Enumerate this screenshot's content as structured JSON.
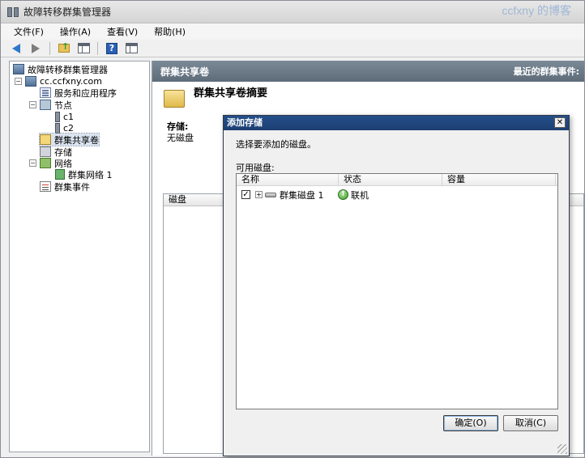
{
  "window": {
    "title": "故障转移群集管理器",
    "watermark": "ccfxny 的博客"
  },
  "menu": [
    "文件(F)",
    "操作(A)",
    "查看(V)",
    "帮助(H)"
  ],
  "tree": {
    "root": "故障转移群集管理器",
    "cluster": "cc.ccfxny.com",
    "apps": "服务和应用程序",
    "nodes": "节点",
    "node1": "c1",
    "node2": "c2",
    "csv": "群集共享卷",
    "storage": "存储",
    "networks": "网络",
    "network1": "群集网络 1",
    "events": "群集事件"
  },
  "right_pane": {
    "header": "群集共享卷",
    "recent_events": "最近的群集事件:",
    "summary_title": "群集共享卷摘要",
    "storage_label": "存储:",
    "storage_value": "无磁盘",
    "disk_column": "磁盘"
  },
  "dialog": {
    "title": "添加存储",
    "close": "✕",
    "prompt": "选择要添加的磁盘。",
    "available_label": "可用磁盘:",
    "columns": [
      "名称",
      "状态",
      "容量"
    ],
    "rows": [
      {
        "checked": true,
        "name": "群集磁盘 1",
        "status": "联机",
        "capacity": ""
      }
    ],
    "ok_label": "确定(O)",
    "cancel_label": "取消(C)"
  }
}
